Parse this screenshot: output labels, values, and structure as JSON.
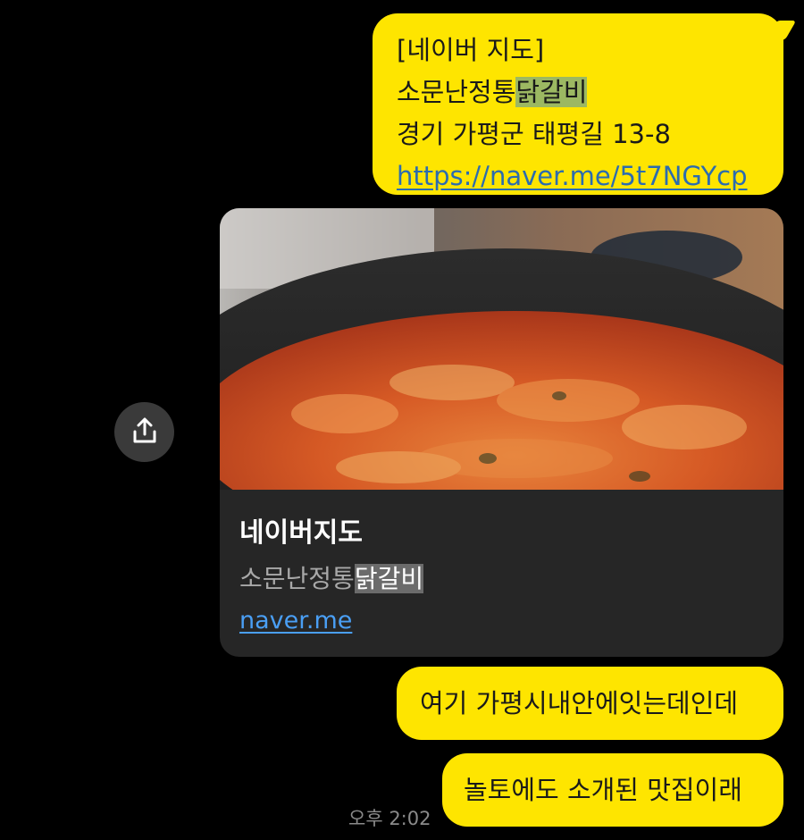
{
  "messages": {
    "first": {
      "line1": "[네이버 지도]",
      "line2_plain": "소문난정통",
      "line2_highlight": "닭갈비",
      "line3": "경기 가평군 태평길 13-8",
      "link": "https://naver.me/5t7NGYcp"
    },
    "second": "여기 가평시내안에잇는데인데",
    "third": "놀토에도 소개된 맛집이래",
    "timestamp": "오후 2:02"
  },
  "link_preview": {
    "title": "네이버지도",
    "subtitle_plain": "소문난정통",
    "subtitle_highlight": "닭갈비",
    "url": "naver.me",
    "image": "dakgalbi-food-photo"
  },
  "share_button": {
    "icon": "share-upload-icon"
  },
  "colors": {
    "background": "#000000",
    "bubble": "#FEE500",
    "card": "#262626",
    "link": "#4a9ff5"
  }
}
